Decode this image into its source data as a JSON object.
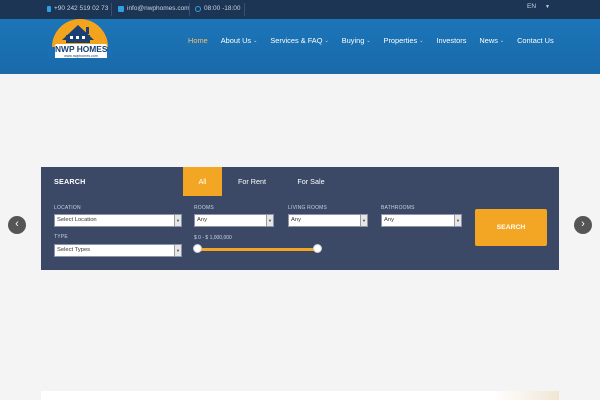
{
  "topbar": {
    "phone": "+90 242 519 02 73",
    "email": "info@nwphomes.com",
    "hours": "08:00 -18:00",
    "language": "EN"
  },
  "logo": {
    "name": "NWP HOMES",
    "url": "www.nwphomes.com"
  },
  "nav": {
    "items": [
      {
        "label": "Home",
        "dropdown": false
      },
      {
        "label": "About Us",
        "dropdown": true
      },
      {
        "label": "Services & FAQ",
        "dropdown": true
      },
      {
        "label": "Buying",
        "dropdown": true
      },
      {
        "label": "Properties",
        "dropdown": true
      },
      {
        "label": "Investors",
        "dropdown": false
      },
      {
        "label": "News",
        "dropdown": true
      },
      {
        "label": "Contact Us",
        "dropdown": false
      }
    ]
  },
  "search": {
    "title": "SEARCH",
    "tabs": [
      "All",
      "For Rent",
      "For Sale"
    ],
    "location_label": "LOCATION",
    "location_value": "Select Location",
    "type_label": "TYPE",
    "type_value": "Select Types",
    "rooms_label": "ROOMS",
    "rooms_value": "Any",
    "living_label": "LIVING ROOMS",
    "living_value": "Any",
    "bath_label": "BATHROOMS",
    "bath_value": "Any",
    "price_range": "$ 0 - $ 1,000,000",
    "button": "SEARCH"
  },
  "slider": {
    "prev": "‹",
    "next": "›"
  },
  "colors": {
    "accent": "#f3a623",
    "header": "#1b75b8",
    "topbar": "#1d3554",
    "panel": "#3b4966"
  }
}
